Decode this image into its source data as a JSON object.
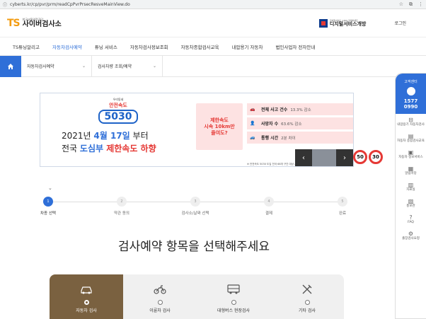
{
  "browser": {
    "url": "cyberts.kr/cp/pvr/prm/readCpPvrPrsecResveMainView.do"
  },
  "header": {
    "logo_mark": "TS",
    "logo_small": "한국교통안전공단",
    "logo_big": "사이버검사소",
    "digital_small": "모바일서비스 1369 검색하세요",
    "digital_big": "디지털서비스개방",
    "login": "로그인"
  },
  "gnb": [
    "TS튜닝알리고",
    "자동차검사예약",
    "튜닝 서비스",
    "자동차검사정보조회",
    "자동차종합검사교육",
    "내압용기 자동차",
    "법인사업자 전자안내"
  ],
  "subnav": {
    "sel1": "자동차검사예약",
    "sel2": "검사차량 조회/예약"
  },
  "banner": {
    "logo_top": "우리동네",
    "logo_mid": "안전속도",
    "logo_num": "5030",
    "line1_pre": "2021년 ",
    "line1_date": "4월 17일",
    "line1_post": " 부터",
    "line2_pre": "전국 ",
    "line2_strong": "도심부",
    "line2_red": " 제한속도 하향",
    "pink_text": "제한속도\n시속 10km만\n줄여도?",
    "stats": [
      {
        "label": "전체 사고 건수",
        "value": "13.3% 감소"
      },
      {
        "label": "사망자 수",
        "value": "63.6% 감소"
      },
      {
        "label": "통행 시간",
        "value": "2분 차이"
      }
    ],
    "note": "※ 안전속도 5030 도입 전국 68개 구간 대상 시행 전후 교통사고 감소 효과 분석 결과 (대한교통학회)",
    "sign1": "50",
    "sign2": "30"
  },
  "steps": [
    {
      "num": "1",
      "label": "차종 선택"
    },
    {
      "num": "2",
      "label": "약관 동의"
    },
    {
      "num": "3",
      "label": "검사소/날짜 선택"
    },
    {
      "num": "4",
      "label": "결제"
    },
    {
      "num": "5",
      "label": "완료"
    }
  ],
  "heading": "검사예약 항목을 선택해주세요",
  "cards": [
    {
      "label": "자동차 검사",
      "icon": "car-icon"
    },
    {
      "label": "이륜차 검사",
      "icon": "motorcycle-icon"
    },
    {
      "label": "대형버스 현장검사",
      "icon": "bus-icon"
    },
    {
      "label": "기타 검사",
      "icon": "tools-icon"
    }
  ],
  "quick_menu": {
    "title": "고객센터",
    "phone_1": "1577",
    "phone_2": "0990",
    "items": [
      "내압용기 자동차검사",
      "자동차 종합검사교육",
      "자동차 정보서비스",
      "알림마당",
      "자료실",
      "홍보관",
      "FAQ",
      "출장검사요청"
    ]
  },
  "colors": {
    "primary": "#2f6fd8",
    "card_active": "#7a6140",
    "accent_red": "#e53935"
  }
}
